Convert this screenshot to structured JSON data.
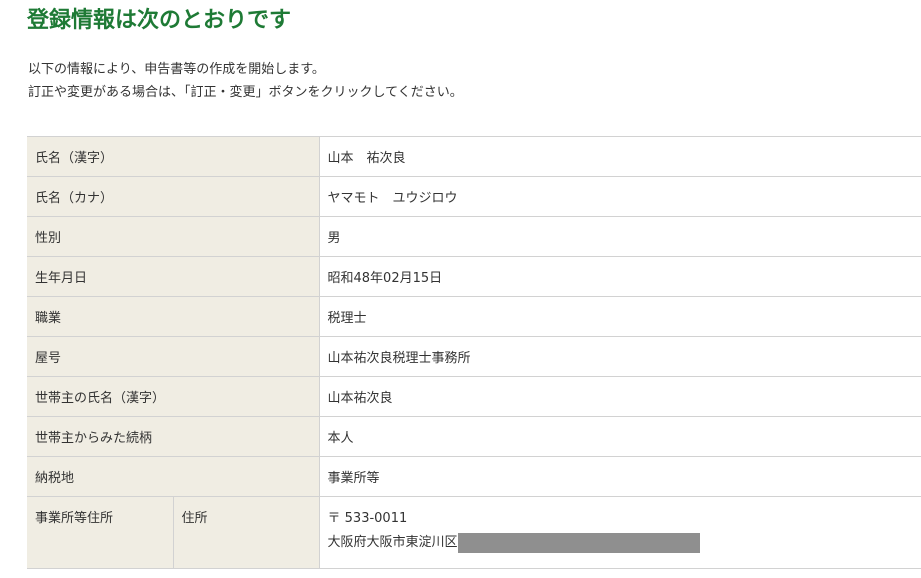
{
  "page": {
    "title": "登録情報は次のとおりです",
    "intro_line1": "以下の情報により、申告書等の作成を開始します。",
    "intro_line2": "訂正や変更がある場合は、「訂正・変更」ボタンをクリックしてください。"
  },
  "rows": [
    {
      "label": "氏名（漢字）",
      "value": "山本　祐次良"
    },
    {
      "label": "氏名（カナ）",
      "value": "ヤマモト　ユウジロウ"
    },
    {
      "label": "性別",
      "value": "男"
    },
    {
      "label": "生年月日",
      "value": "昭和48年02月15日"
    },
    {
      "label": "職業",
      "value": "税理士"
    },
    {
      "label": "屋号",
      "value": "山本祐次良税理士事務所"
    },
    {
      "label": "世帯主の氏名（漢字）",
      "value": "山本祐次良"
    },
    {
      "label": "世帯主からみた続柄",
      "value": "本人"
    },
    {
      "label": "納税地",
      "value": "事業所等"
    }
  ],
  "address": {
    "label": "事業所等住所",
    "sub_label": "住所",
    "postal": "〒 533-0011",
    "line": "大阪府大阪市東淀川区"
  },
  "colors": {
    "title_green": "#1e7a35",
    "label_bg": "#f0ede3",
    "border": "#d2d2d2",
    "redaction": "#8f8f8f"
  }
}
